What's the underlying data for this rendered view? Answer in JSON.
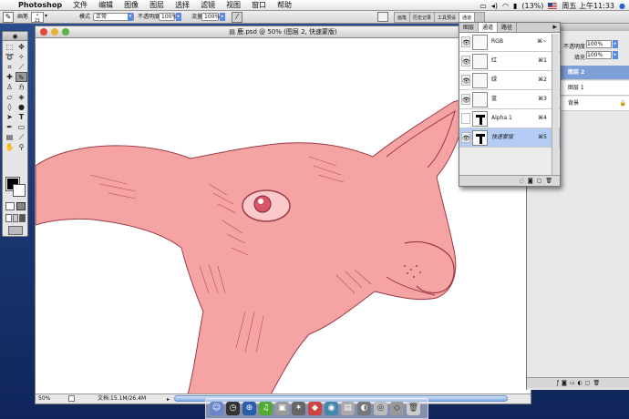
{
  "menubar": {
    "app_name": "Photoshop",
    "items": [
      "文件",
      "编辑",
      "图像",
      "图层",
      "选择",
      "滤镜",
      "视图",
      "窗口",
      "帮助"
    ],
    "battery": "(13%)",
    "clock": "周五 上午11:33"
  },
  "options": {
    "brush_label": "画笔",
    "brush_size": "21",
    "mode_label": "模式",
    "mode_value": "正常",
    "opacity_label": "不透明度",
    "opacity_value": "100%",
    "flow_label": "流量",
    "flow_value": "100%",
    "well_tabs": [
      "画笔",
      "历史记录",
      "工具预设",
      "通道"
    ]
  },
  "document": {
    "title": "鹿.psd @ 50% (图层 2, 快速蒙版)",
    "zoom": "50%",
    "file_size": "文档:15.1M/26.4M"
  },
  "channels": {
    "tabs": [
      "图层",
      "通道",
      "路径"
    ],
    "rows": [
      {
        "name": "RGB",
        "key": "⌘~"
      },
      {
        "name": "红",
        "key": "⌘1"
      },
      {
        "name": "绿",
        "key": "⌘2"
      },
      {
        "name": "蓝",
        "key": "⌘3"
      },
      {
        "name": "Alpha 1",
        "key": "⌘4"
      },
      {
        "name": "快速蒙版",
        "key": "⌘5"
      }
    ]
  },
  "layers": {
    "opacity_label": "不透明度",
    "opacity_value": "100%",
    "fill_label": "填充",
    "fill_value": "100%",
    "items": [
      "图层 2",
      "图层 1",
      "背景"
    ]
  },
  "colors": {
    "mask": "#f6a3a3",
    "line": "#9c3a46",
    "selection": "#b5cdf5"
  }
}
